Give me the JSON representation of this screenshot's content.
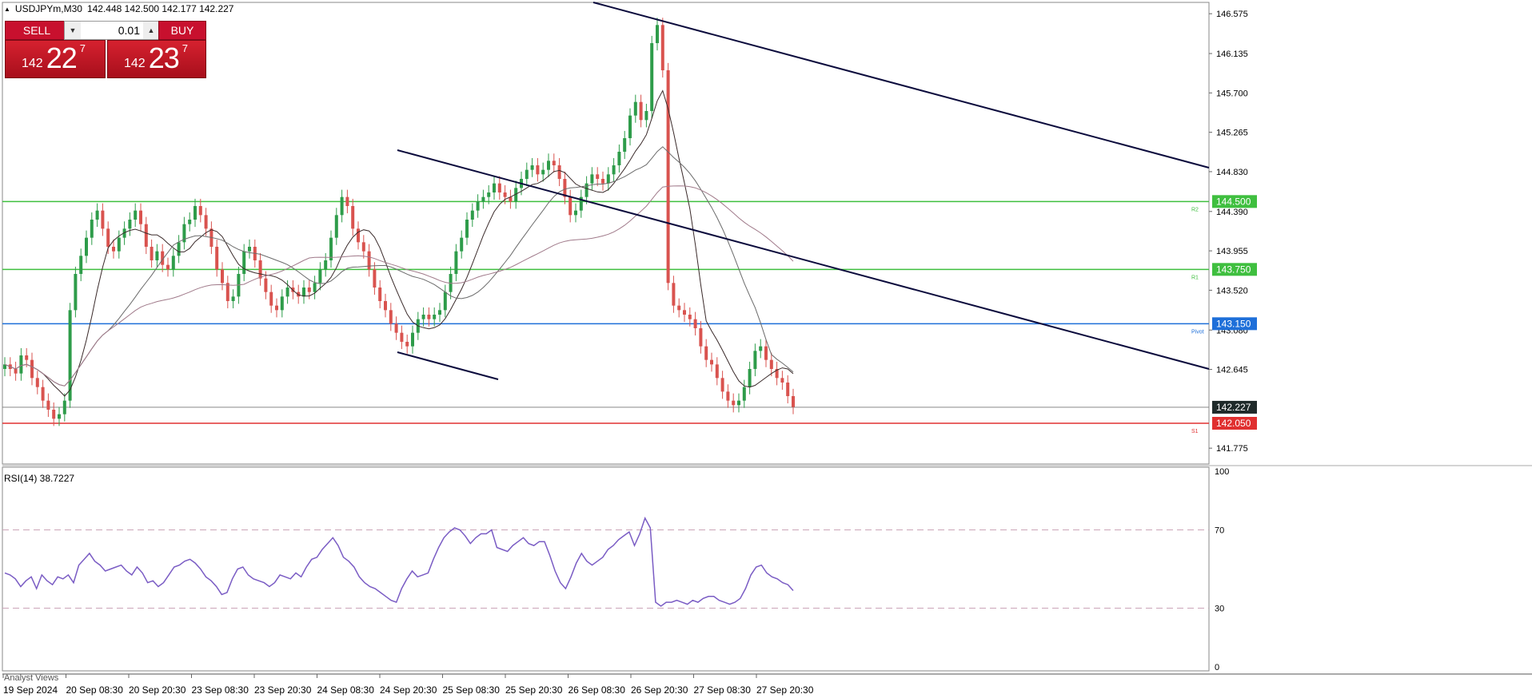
{
  "header": {
    "symbol": "USDJPYm,M30",
    "ohlc": "142.448 142.500 142.177 142.227"
  },
  "trade_panel": {
    "sell_label": "SELL",
    "buy_label": "BUY",
    "lot_value": "0.01",
    "bid": {
      "prefix": "142",
      "big": "22",
      "sup": "7"
    },
    "ask": {
      "prefix": "142",
      "big": "23",
      "sup": "7"
    }
  },
  "price_axis": {
    "ticks": [
      "146.575",
      "146.135",
      "145.700",
      "145.265",
      "144.830",
      "144.390",
      "143.955",
      "143.520",
      "143.080",
      "142.645",
      "141.775"
    ]
  },
  "levels": [
    {
      "label": "144.500",
      "value": 144.5,
      "tag": "R2",
      "color": "#3fbf3f"
    },
    {
      "label": "143.750",
      "value": 143.75,
      "tag": "R1",
      "color": "#3fbf3f"
    },
    {
      "label": "143.150",
      "value": 143.15,
      "tag": "Pivot",
      "color": "#1e6fd9"
    },
    {
      "label": "142.050",
      "value": 142.05,
      "tag": "S1",
      "color": "#e03030"
    }
  ],
  "current_price": {
    "label": "142.227",
    "value": 142.227
  },
  "rsi": {
    "label": "RSI(14) 38.7227",
    "ticks": [
      "100",
      "70",
      "30",
      "0"
    ]
  },
  "time_axis": {
    "labels": [
      "19 Sep 2024",
      "20 Sep 08:30",
      "20 Sep 20:30",
      "23 Sep 08:30",
      "23 Sep 20:30",
      "24 Sep 08:30",
      "24 Sep 20:30",
      "25 Sep 08:30",
      "25 Sep 20:30",
      "26 Sep 08:30",
      "26 Sep 20:30",
      "27 Sep 08:30",
      "27 Sep 20:30"
    ]
  },
  "bottom_tab": "Analyst Views",
  "colors": {
    "bull_candle": "#2e9c4a",
    "bear_candle": "#d9534f",
    "rsi_line": "#7a5cc4",
    "trendline": "#0a0a3c"
  },
  "chart_data": {
    "type": "candlestick",
    "close_series": [
      142.7,
      142.65,
      142.6,
      142.8,
      142.75,
      142.55,
      142.45,
      142.3,
      142.2,
      142.1,
      142.15,
      142.3,
      143.3,
      143.7,
      143.9,
      144.1,
      144.3,
      144.4,
      144.2,
      144.0,
      143.95,
      144.1,
      144.2,
      144.3,
      144.4,
      144.25,
      144.0,
      143.85,
      143.95,
      143.8,
      143.75,
      143.9,
      144.05,
      144.25,
      144.3,
      144.45,
      144.35,
      144.2,
      144.0,
      143.75,
      143.6,
      143.4,
      143.45,
      143.7,
      143.95,
      144.0,
      143.85,
      143.65,
      143.5,
      143.35,
      143.3,
      143.45,
      143.55,
      143.5,
      143.45,
      143.55,
      143.5,
      143.6,
      143.75,
      143.85,
      144.1,
      144.35,
      144.55,
      144.45,
      144.2,
      144.05,
      143.95,
      143.75,
      143.55,
      143.4,
      143.3,
      143.15,
      143.05,
      142.95,
      142.9,
      143.05,
      143.2,
      143.25,
      143.2,
      143.25,
      143.3,
      143.5,
      143.7,
      143.95,
      144.1,
      144.3,
      144.4,
      144.5,
      144.55,
      144.6,
      144.7,
      144.6,
      144.55,
      144.5,
      144.65,
      144.75,
      144.85,
      144.9,
      144.8,
      144.85,
      144.95,
      144.9,
      144.75,
      144.55,
      144.35,
      144.4,
      144.55,
      144.7,
      144.8,
      144.75,
      144.7,
      144.8,
      144.9,
      145.05,
      145.2,
      145.45,
      145.6,
      145.4,
      145.5,
      146.25,
      146.45,
      145.95,
      143.6,
      143.35,
      143.3,
      143.25,
      143.2,
      143.1,
      142.9,
      142.75,
      142.7,
      142.55,
      142.4,
      142.3,
      142.25,
      142.3,
      142.45,
      142.65,
      142.85,
      142.9,
      142.75,
      142.65,
      142.55,
      142.5,
      142.35,
      142.23
    ],
    "time_labels": [
      "19 Sep 2024",
      "20 Sep 08:30",
      "20 Sep 20:30",
      "23 Sep 08:30",
      "23 Sep 20:30",
      "24 Sep 08:30",
      "24 Sep 20:30",
      "25 Sep 08:30",
      "25 Sep 20:30",
      "26 Sep 08:30",
      "26 Sep 20:30",
      "27 Sep 08:30",
      "27 Sep 20:30"
    ],
    "y_range": [
      141.6,
      146.7
    ],
    "rsi_series": [
      48,
      47,
      45,
      41,
      44,
      46,
      40,
      47,
      44,
      42,
      46,
      45,
      47,
      43,
      52,
      55,
      58,
      54,
      52,
      49,
      50,
      51,
      52,
      49,
      47,
      51,
      48,
      43,
      44,
      41,
      43,
      47,
      51,
      52,
      54,
      55,
      53,
      50,
      46,
      44,
      41,
      37,
      38,
      45,
      50,
      51,
      47,
      45,
      44,
      43,
      41,
      43,
      47,
      46,
      45,
      48,
      46,
      51,
      55,
      56,
      60,
      63,
      66,
      62,
      56,
      54,
      51,
      46,
      43,
      41,
      40,
      38,
      36,
      34,
      33,
      40,
      45,
      49,
      46,
      47,
      48,
      55,
      61,
      66,
      69,
      71,
      70,
      67,
      63,
      66,
      68,
      68,
      70,
      61,
      60,
      59,
      62,
      64,
      66,
      63,
      62,
      64,
      64,
      57,
      49,
      43,
      40,
      46,
      53,
      58,
      54,
      52,
      54,
      56,
      60,
      62,
      65,
      67,
      69,
      62,
      68,
      76,
      71,
      33,
      31,
      33,
      33,
      34,
      33,
      32,
      34,
      33,
      35,
      36,
      36,
      34,
      33,
      32,
      33,
      35,
      40,
      47,
      51,
      52,
      48,
      46,
      45,
      43,
      42,
      39
    ],
    "rsi_range": [
      0,
      100
    ],
    "rsi_levels": [
      70,
      30
    ]
  }
}
